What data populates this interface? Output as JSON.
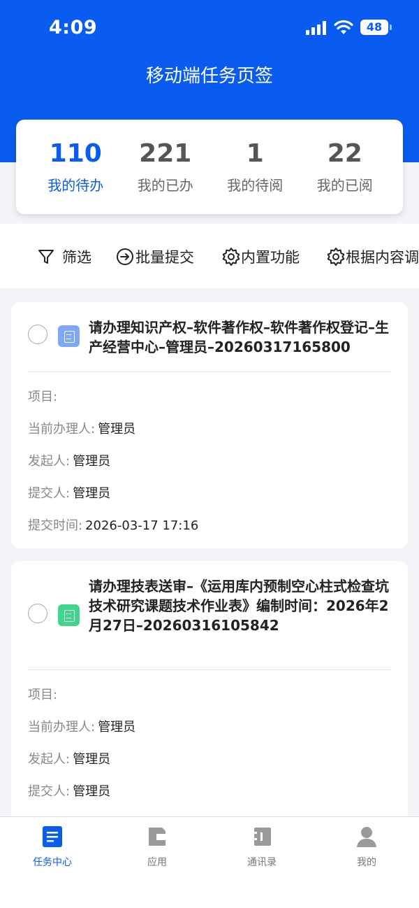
{
  "status_bar": {
    "time": "4:09",
    "battery": "48"
  },
  "header": {
    "title": "移动端任务页签"
  },
  "stats": [
    {
      "count": "110",
      "label": "我的待办"
    },
    {
      "count": "221",
      "label": "我的已办"
    },
    {
      "count": "1",
      "label": "我的待阅"
    },
    {
      "count": "22",
      "label": "我的已阅"
    }
  ],
  "toolbar": {
    "filter": "筛选",
    "batch_submit": "批量提交",
    "builtin": "内置功能",
    "by_content": "根据内容调"
  },
  "field_labels": {
    "project": "项目:",
    "current_handler": "当前办理人:",
    "initiator": "发起人:",
    "submitter": "提交人:",
    "submit_time": "提交时间:"
  },
  "tasks": [
    {
      "title": "请办理知识产权–软件著作权–软件著作权登记–生产经营中心–管理员–20260317165800",
      "icon_color": "#7ea7f5",
      "project": "",
      "current_handler": "管理员",
      "initiator": "管理员",
      "submitter": "管理员",
      "submit_time": "2026-03-17 17:16"
    },
    {
      "title": "请办理技表送审–《运用库内预制空心柱式检查坑技术研究课题技术作业表》编制时间：2026年2月27日–20260316105842",
      "icon_color": "#3dd68c",
      "project": "",
      "current_handler": "管理员",
      "initiator": "管理员",
      "submitter": "管理员"
    }
  ],
  "tabbar": [
    {
      "label": "任务中心",
      "icon": "task-doc-icon"
    },
    {
      "label": "应用",
      "icon": "apps-icon"
    },
    {
      "label": "通讯录",
      "icon": "contacts-icon"
    },
    {
      "label": "我的",
      "icon": "user-icon"
    }
  ],
  "colors": {
    "brand": "#0a5cf0",
    "background": "#f3f4f7"
  }
}
